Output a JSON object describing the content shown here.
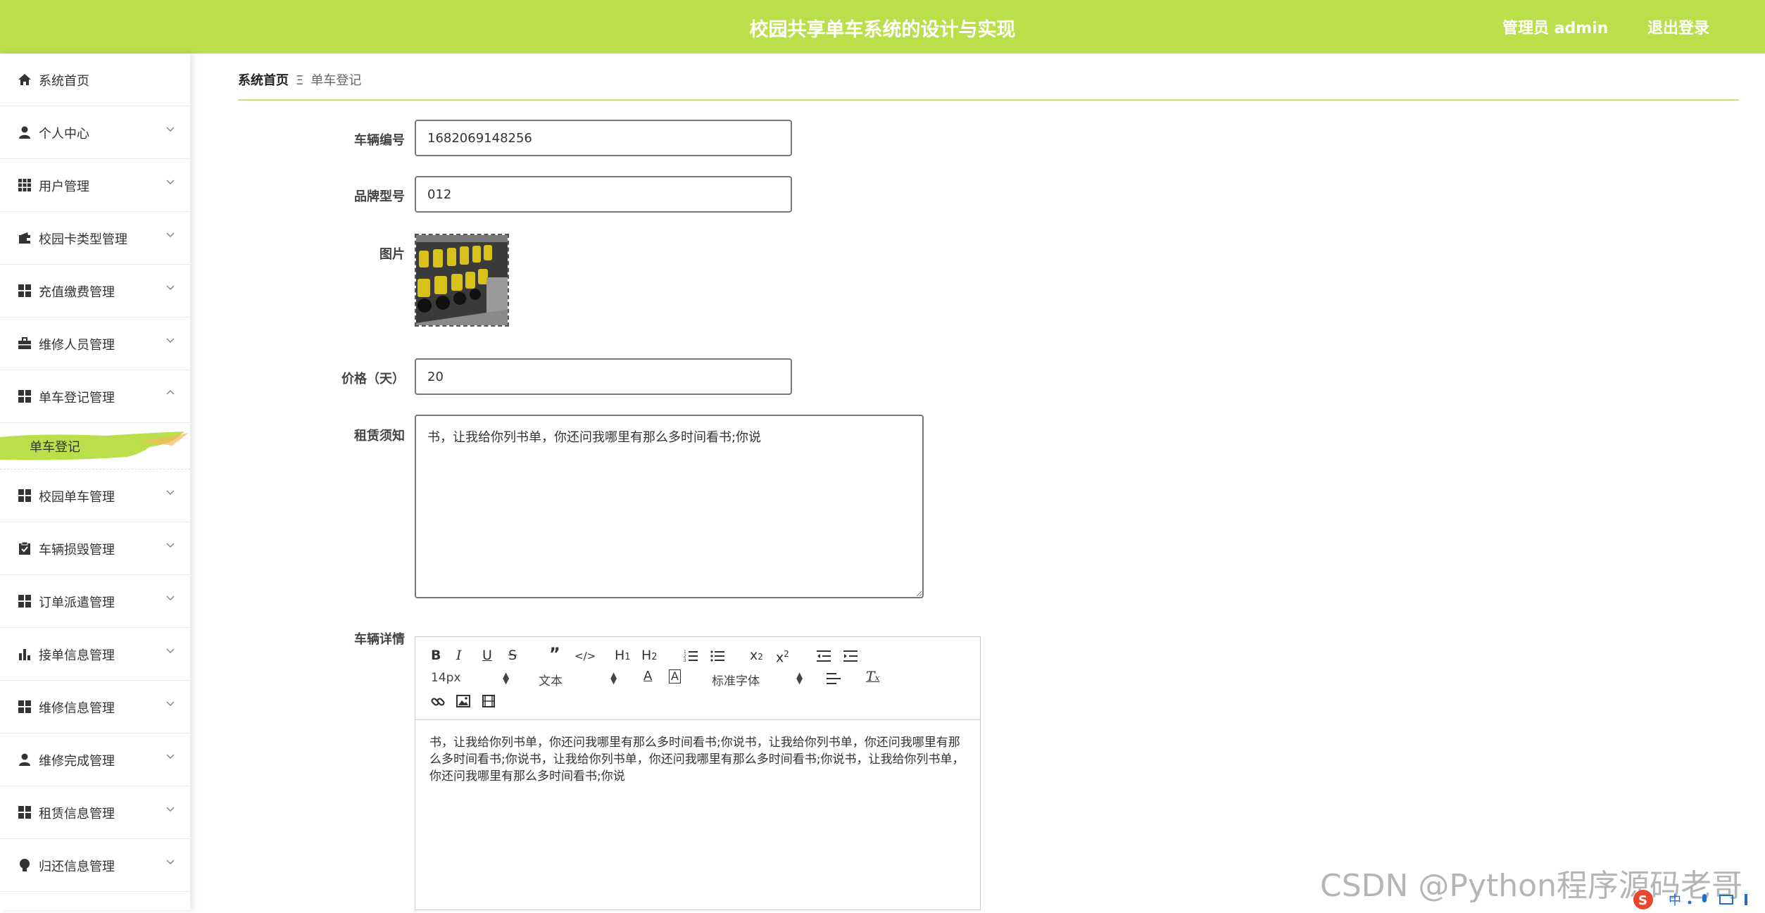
{
  "header": {
    "title": "校园共享单车系统的设计与实现",
    "user": "管理员 admin",
    "logout": "退出登录",
    "bg_color": "#b9df4b"
  },
  "sidebar": {
    "items": [
      {
        "label": "系统首页",
        "icon": "home-icon"
      },
      {
        "label": "个人中心",
        "icon": "user-icon"
      },
      {
        "label": "用户管理",
        "icon": "grid-icon"
      },
      {
        "label": "校园卡类型管理",
        "icon": "wallet-icon"
      },
      {
        "label": "充值缴费管理",
        "icon": "apps-icon"
      },
      {
        "label": "维修人员管理",
        "icon": "briefcase-icon"
      },
      {
        "label": "单车登记管理",
        "icon": "apps-icon"
      },
      {
        "label": "校园单车管理",
        "icon": "apps-icon"
      },
      {
        "label": "车辆损毁管理",
        "icon": "clipboard-icon"
      },
      {
        "label": "订单派遣管理",
        "icon": "apps-icon"
      },
      {
        "label": "接单信息管理",
        "icon": "bar-chart-icon"
      },
      {
        "label": "维修信息管理",
        "icon": "apps-icon"
      },
      {
        "label": "维修完成管理",
        "icon": "user-icon"
      },
      {
        "label": "租赁信息管理",
        "icon": "apps-icon"
      },
      {
        "label": "归还信息管理",
        "icon": "bulb-icon"
      }
    ],
    "sub_item": "单车登记",
    "accent_color": "#b9df4b"
  },
  "breadcrumb": {
    "home": "系统首页",
    "separator": "Ξ",
    "current": "单车登记"
  },
  "form": {
    "vehicle_no_label": "车辆编号",
    "vehicle_no_value": "1682069148256",
    "brand_label": "品牌型号",
    "brand_value": "012",
    "picture_label": "图片",
    "price_label": "价格（天）",
    "price_value": "20",
    "notice_label": "租赁须知",
    "notice_value": "书，让我给你列书单，你还问我哪里有那么多时间看书;你说",
    "detail_label": "车辆详情"
  },
  "editor": {
    "font_size": "14px",
    "text_type": "文本",
    "font_family": "标准字体",
    "content": "书，让我给你列书单，你还问我哪里有那么多时间看书;你说书，让我给你列书单，你还问我哪里有那么多时间看书;你说书，让我给你列书单，你还问我哪里有那么多时间看书;你说书，让我给你列书单，你还问我哪里有那么多时间看书;你说"
  },
  "watermark": "CSDN @Python程序源码老哥",
  "ime": {
    "lang": "中"
  }
}
